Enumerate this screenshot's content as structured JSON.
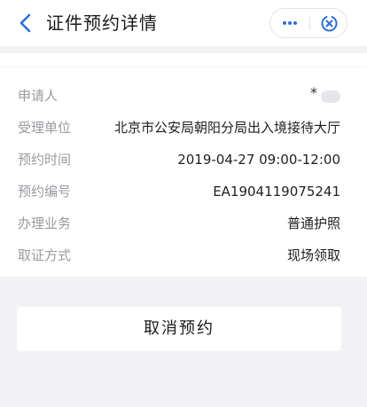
{
  "header": {
    "back_icon": "chevron-left-icon",
    "title": "证件预约详情",
    "more_icon": "more-dots-icon",
    "close_icon": "close-circle-icon",
    "accent_color": "#2c6fd6"
  },
  "details": [
    {
      "label": "申请人",
      "value": "*",
      "masked": true
    },
    {
      "label": "受理单位",
      "value": "北京市公安局朝阳分局出入境接待大厅"
    },
    {
      "label": "预约时间",
      "value": "2019-04-27 09:00-12:00"
    },
    {
      "label": "预约编号",
      "value": "EA1904119075241"
    },
    {
      "label": "办理业务",
      "value": "普通护照"
    },
    {
      "label": "取证方式",
      "value": "现场领取"
    }
  ],
  "actions": {
    "cancel_label": "取消预约"
  }
}
